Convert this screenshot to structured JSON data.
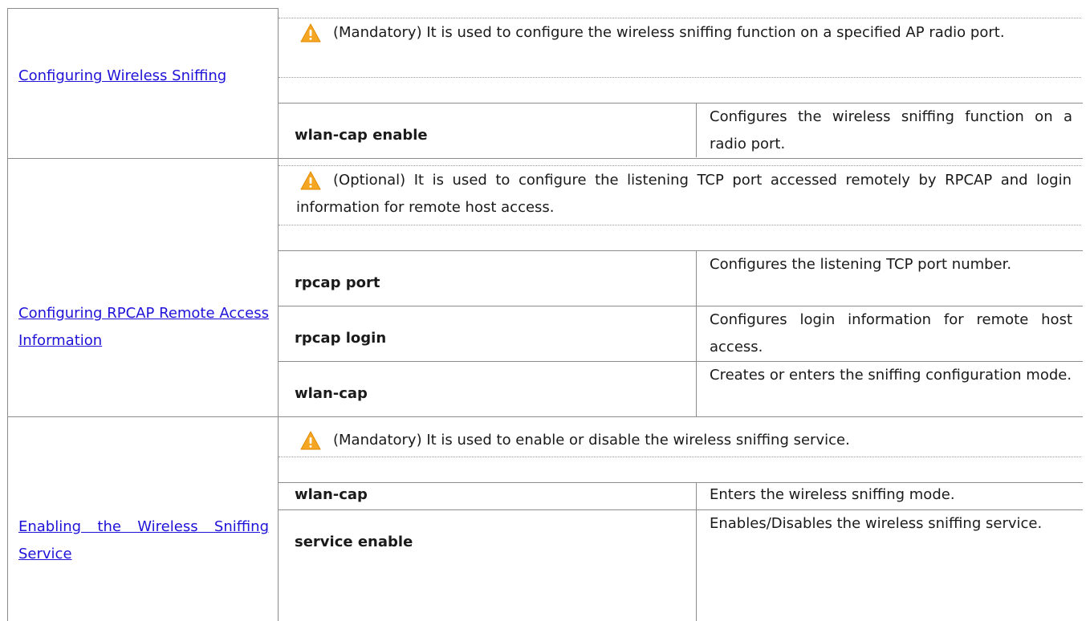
{
  "rows": [
    {
      "link": "Configuring Wireless Sniffing",
      "note": "(Mandatory) It is used to configure the wireless sniffing function on a specified AP radio port.",
      "commands": [
        {
          "cmd": "wlan-cap enable",
          "desc": "Configures the wireless sniffing function on a radio port."
        }
      ]
    },
    {
      "link": "Configuring RPCAP Remote Access Information",
      "note": "(Optional) It is used to configure the listening TCP port accessed remotely by RPCAP and login information for remote host access.",
      "commands": [
        {
          "cmd": "rpcap port",
          "desc": "Configures the listening TCP port number."
        },
        {
          "cmd": "rpcap login",
          "desc": "Configures login information for remote host access."
        },
        {
          "cmd": "wlan-cap",
          "desc": "Creates or enters the sniffing configuration mode."
        }
      ]
    },
    {
      "link": "Enabling the Wireless Sniffing Service",
      "note": "(Mandatory) It is used to enable or disable the wireless sniffing service.",
      "commands": [
        {
          "cmd": "wlan-cap",
          "desc": "Enters the wireless sniffing mode."
        },
        {
          "cmd": "service enable",
          "desc": "Enables/Disables the wireless sniffing service."
        }
      ]
    }
  ],
  "colors": {
    "link": "#1f12d8",
    "border": "#8c8c8c",
    "warning": "#f5a623"
  },
  "icons": {
    "warning": "warning-icon"
  }
}
